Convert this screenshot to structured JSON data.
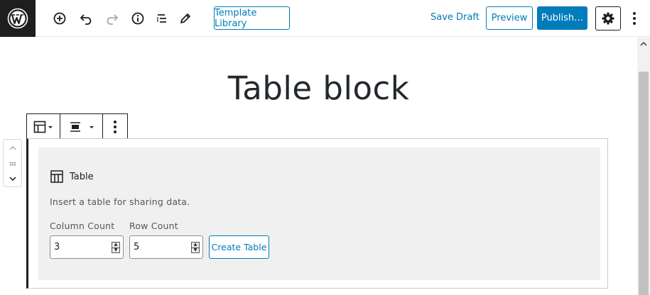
{
  "toolbar": {
    "template_library_label": "Template Library",
    "save_draft_label": "Save Draft",
    "preview_label": "Preview",
    "publish_label": "Publish…"
  },
  "icons": {
    "logo": "wordpress-icon",
    "add": "add-block-icon",
    "undo": "undo-icon",
    "redo": "redo-icon",
    "info": "info-icon",
    "outline": "list-view-icon",
    "edit": "pencil-icon",
    "settings": "gear-icon",
    "more": "kebab-icon"
  },
  "page": {
    "title": "Table block"
  },
  "block": {
    "label": "Table",
    "instructions": "Insert a table for sharing data.",
    "column_count_label": "Column Count",
    "column_count_value": "3",
    "row_count_label": "Row Count",
    "row_count_value": "5",
    "create_label": "Create Table"
  },
  "colors": {
    "accent": "#007cba",
    "dark": "#1e1e1e",
    "placeholder_bg": "#f0f0f1"
  }
}
